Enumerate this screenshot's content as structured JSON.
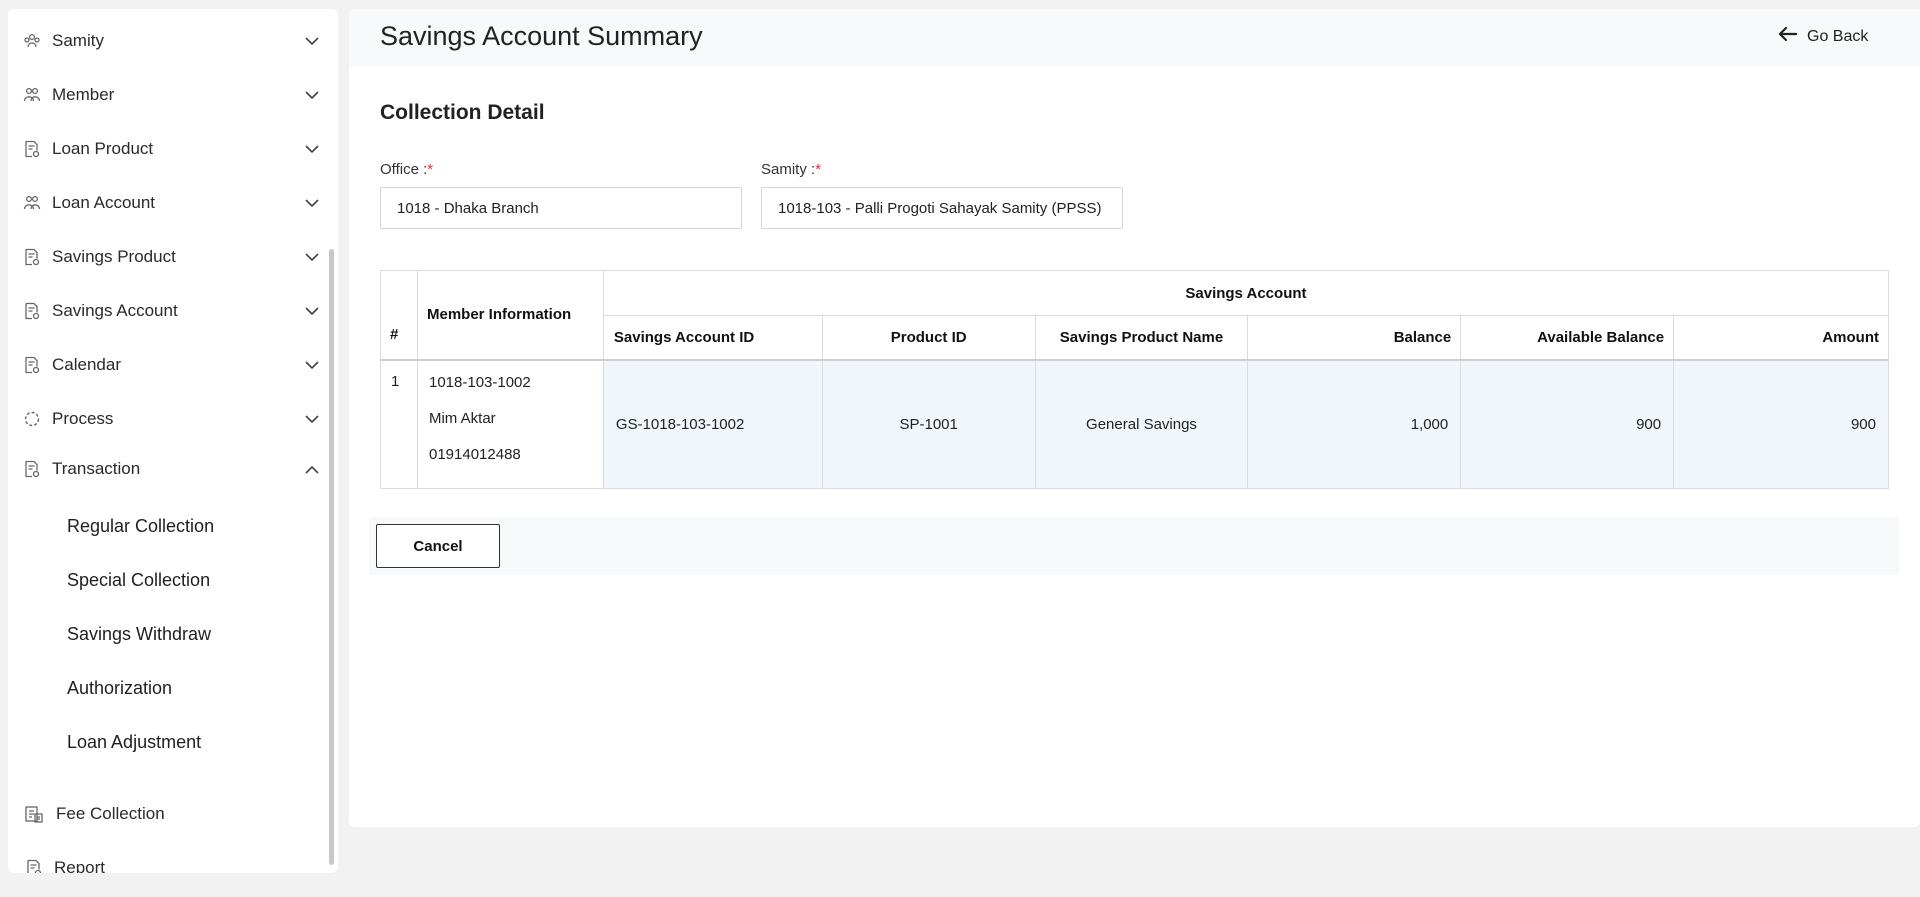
{
  "sidebar": {
    "items": [
      {
        "label": "Samity",
        "icon": "samity-icon",
        "expanded": false
      },
      {
        "label": "Member",
        "icon": "member-icon",
        "expanded": false
      },
      {
        "label": "Loan Product",
        "icon": "document-icon",
        "expanded": false
      },
      {
        "label": "Loan Account",
        "icon": "member-icon",
        "expanded": false
      },
      {
        "label": "Savings Product",
        "icon": "document-icon",
        "expanded": false
      },
      {
        "label": "Savings Account",
        "icon": "document-icon",
        "expanded": false
      },
      {
        "label": "Calendar",
        "icon": "document-icon",
        "expanded": false
      },
      {
        "label": "Process",
        "icon": "process-icon",
        "expanded": false
      },
      {
        "label": "Transaction",
        "icon": "document-icon",
        "expanded": true
      }
    ],
    "transaction_sub": [
      "Regular Collection",
      "Special Collection",
      "Savings Withdraw",
      "Authorization",
      "Loan Adjustment"
    ],
    "fee_collection": "Fee Collection",
    "report": "Report"
  },
  "header": {
    "title": "Savings Account Summary",
    "go_back": "Go Back"
  },
  "form": {
    "section_title": "Collection Detail",
    "office_label": "Office :",
    "office_value": "1018 - Dhaka Branch",
    "samity_label": "Samity :",
    "samity_value": "1018-103 - Palli Progoti Sahayak Samity (PPSS)",
    "required_mark": "*"
  },
  "table": {
    "hash_header": "#",
    "member_header": "Member Information",
    "group_header": "Savings Account",
    "columns": [
      "Savings Account ID",
      "Product ID",
      "Savings Product Name",
      "Balance",
      "Available Balance",
      "Amount"
    ],
    "rows": [
      {
        "index": "1",
        "member_id": "1018-103-1002",
        "member_name": "Mim Aktar",
        "member_phone": "01914012488",
        "account_id": "GS-1018-103-1002",
        "product_id": "SP-1001",
        "product_name": "General Savings",
        "balance": "1,000",
        "available_balance": "900",
        "amount": "900"
      }
    ]
  },
  "actions": {
    "cancel": "Cancel"
  }
}
